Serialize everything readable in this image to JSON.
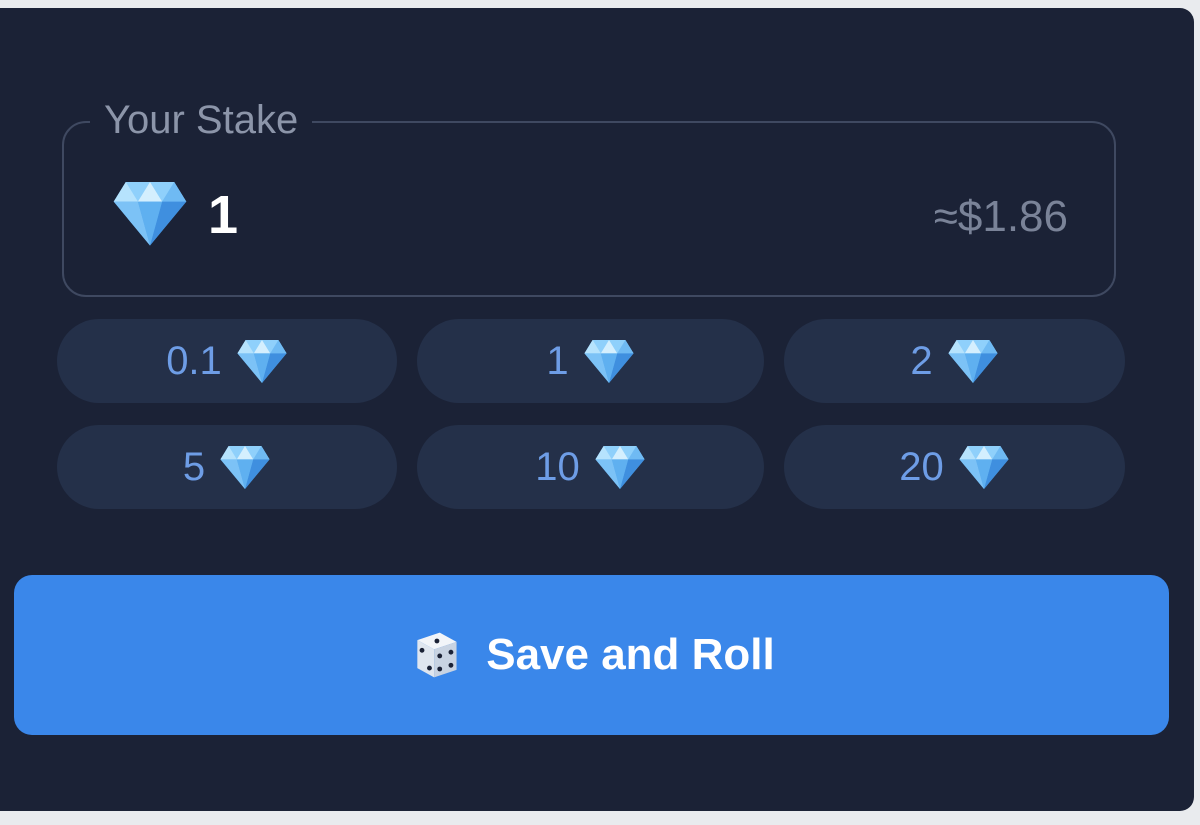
{
  "stake": {
    "label": "Your Stake",
    "value": "1",
    "usd_estimate": "≈$1.86",
    "icon": "diamond-icon"
  },
  "quick_amounts": [
    {
      "label": "0.1",
      "icon": "diamond-icon"
    },
    {
      "label": "1",
      "icon": "diamond-icon"
    },
    {
      "label": "2",
      "icon": "diamond-icon"
    },
    {
      "label": "5",
      "icon": "diamond-icon"
    },
    {
      "label": "10",
      "icon": "diamond-icon"
    },
    {
      "label": "20",
      "icon": "diamond-icon"
    }
  ],
  "action": {
    "label": "Save and Roll",
    "icon": "dice-icon"
  },
  "colors": {
    "panel_bg": "#1b2236",
    "chip_bg": "#243049",
    "chip_text": "#6e9de6",
    "button_bg": "#3a87ea",
    "diamond": "#6fb7f2"
  }
}
